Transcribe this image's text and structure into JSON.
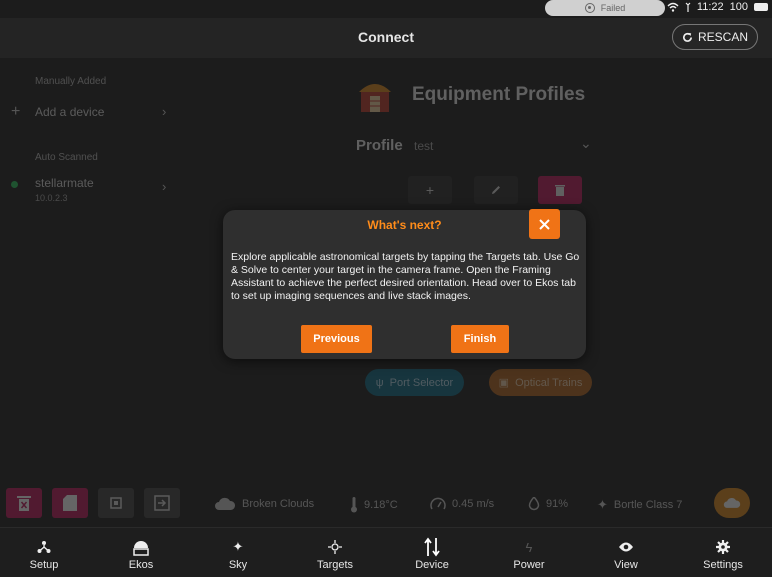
{
  "status_bar": {
    "failed_label": "Failed",
    "time": "11:22",
    "battery": "100"
  },
  "header": {
    "title": "Connect",
    "rescan_label": "RESCAN"
  },
  "devices": {
    "manual_section": "Manually Added",
    "add_device_label": "Add a device",
    "auto_section": "Auto Scanned",
    "scanned": [
      {
        "name": "stellarmate",
        "ip": "10.0.2.3",
        "status_color": "#26c85a"
      }
    ]
  },
  "equipment": {
    "title": "Equipment Profiles",
    "profile_label": "Profile",
    "profile_value": "test",
    "port_selector_label": "Port Selector",
    "optical_trains_label": "Optical Trains"
  },
  "weather": {
    "condition": "Broken Clouds",
    "temperature": "9.18°C",
    "wind": "0.45 m/s",
    "humidity": "91%",
    "bortle": "Bortle Class 7"
  },
  "dialog": {
    "title": "What's next?",
    "body": "Explore applicable astronomical targets by tapping the Targets tab. Use Go & Solve to center your target in the camera frame. Open the Framing Assistant to achieve the perfect desired orientation. Head over to Ekos tab to set up imaging sequences and live stack images.",
    "previous_label": "Previous",
    "finish_label": "Finish"
  },
  "nav": {
    "items": [
      {
        "label": "Setup",
        "icon": "setup-icon"
      },
      {
        "label": "Ekos",
        "icon": "ekos-icon"
      },
      {
        "label": "Sky",
        "icon": "sky-icon"
      },
      {
        "label": "Targets",
        "icon": "targets-icon"
      },
      {
        "label": "Device",
        "icon": "device-icon"
      },
      {
        "label": "Power",
        "icon": "power-icon"
      },
      {
        "label": "View",
        "icon": "view-icon"
      },
      {
        "label": "Settings",
        "icon": "settings-icon"
      }
    ]
  },
  "colors": {
    "accent": "#f07316",
    "dialog_title": "#ff8c1a",
    "danger": "#c2185b",
    "port_selector": "#0e6b86",
    "optical_trains": "#b5651d"
  }
}
